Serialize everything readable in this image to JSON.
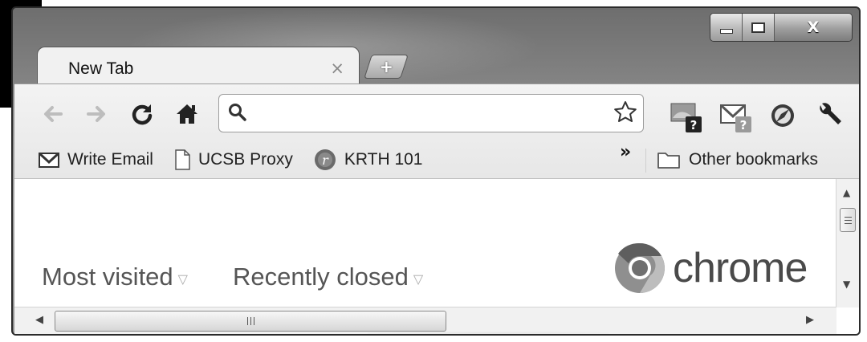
{
  "window": {
    "minimize_label": "",
    "maximize_label": "",
    "close_label": "X"
  },
  "tabs": [
    {
      "title": "New Tab",
      "close_label": "×"
    }
  ],
  "new_tab_label": "+",
  "nav": {
    "back_icon": "back-arrow-icon",
    "forward_icon": "forward-arrow-icon",
    "reload_icon": "reload-icon",
    "home_icon": "home-icon"
  },
  "omnibox": {
    "value": "",
    "placeholder": ""
  },
  "extensions": [
    "screen-capture-extension-icon",
    "gmail-checker-icon",
    "compass-extension-icon",
    "wrench-menu-icon"
  ],
  "bookmarks": [
    {
      "label": "Write Email",
      "icon": "gmail-icon"
    },
    {
      "label": "UCSB Proxy",
      "icon": "page-icon"
    },
    {
      "label": "KRTH 101",
      "icon": "radio-icon"
    }
  ],
  "bookmarks_overflow": "»",
  "other_bookmarks": "Other bookmarks",
  "content": {
    "most_visited": "Most visited",
    "recently_closed": "Recently closed",
    "caret": "▽",
    "logo_text": "chrome"
  }
}
